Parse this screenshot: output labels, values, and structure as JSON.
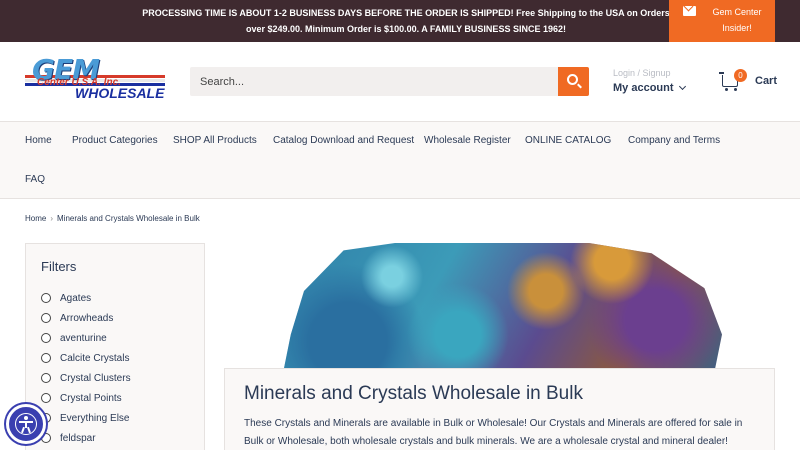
{
  "announcement": {
    "message": "PROCESSING TIME IS ABOUT 1-2 BUSINESS DAYS BEFORE THE ORDER IS SHIPPED! Free Shipping to the USA on Orders over $249.00. Minimum Order is $100.00. A FAMILY BUSINESS SINCE 1962!",
    "insider_label": "Gem Center Insider!"
  },
  "header": {
    "logo": {
      "line1": "GEM",
      "line2": "Center U.S.A. Inc.",
      "line3": "WHOLESALE"
    },
    "search_placeholder": "Search...",
    "account": {
      "login": "Login / Signup",
      "label": "My account"
    },
    "cart": {
      "count": "0",
      "label": "Cart"
    }
  },
  "nav": {
    "items": [
      "Home",
      "Product Categories",
      "SHOP All Products",
      "Catalog Download and Request",
      "Wholesale Register",
      "ONLINE CATALOG",
      "Company and Terms",
      "FAQ"
    ]
  },
  "breadcrumb": {
    "home": "Home",
    "separator": "›",
    "current": "Minerals and Crystals Wholesale in Bulk"
  },
  "filters": {
    "title": "Filters",
    "items": [
      "Agates",
      "Arrowheads",
      "aventurine",
      "Calcite Crystals",
      "Crystal Clusters",
      "Crystal Points",
      "Everything Else",
      "feldspar"
    ]
  },
  "collection": {
    "title": "Minerals and Crystals Wholesale in Bulk",
    "description": "These Crystals and Minerals are available in Bulk or Wholesale! Our Crystals and Minerals are offered for sale in Bulk or Wholesale, both wholesale crystals and bulk minerals.  We are a wholesale crystal and mineral dealer!"
  },
  "colors": {
    "accent": "#f06a23",
    "topbar": "#3f2a30",
    "text": "#2b3a55",
    "accessibility": "#3a3fb0"
  }
}
